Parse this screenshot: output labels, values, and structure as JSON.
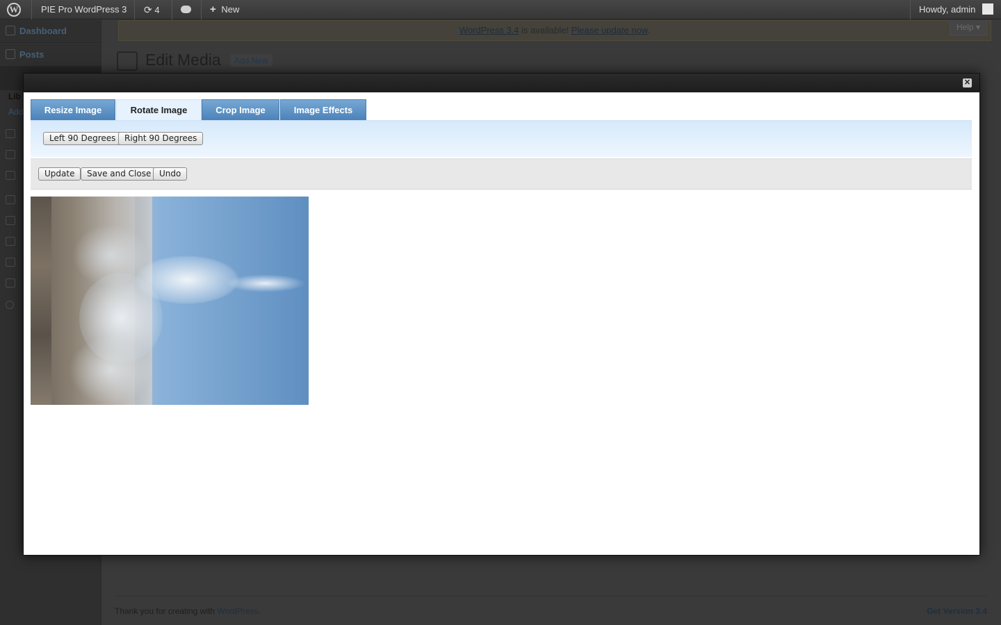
{
  "admin_bar": {
    "site_name": "PIE Pro WordPress 3",
    "updates_count": "4",
    "new_label": "New",
    "greeting": "Howdy, admin"
  },
  "admin_menu": {
    "items": [
      {
        "label": "Dashboard",
        "icon": "home-icon"
      },
      {
        "label": "Posts",
        "icon": "pin-icon"
      }
    ],
    "fragments": {
      "library": "Lib",
      "add": "Add"
    }
  },
  "notice": {
    "link_version": "WordPress 3.4",
    "middle": " is available! ",
    "link_update": "Please update now",
    "end": "."
  },
  "help_tab": "Help",
  "page": {
    "title": "Edit Media",
    "add_new": "Add New"
  },
  "modal": {
    "tabs": [
      {
        "label": "Resize Image",
        "active": false
      },
      {
        "label": "Rotate Image",
        "active": true
      },
      {
        "label": "Crop Image",
        "active": false
      },
      {
        "label": "Image Effects",
        "active": false
      }
    ],
    "rotate_buttons": {
      "left": "Left 90 Degrees",
      "right": "Right 90 Degrees"
    },
    "actions": {
      "update": "Update",
      "save_close": "Save and Close",
      "undo": "Undo"
    },
    "close_glyph": "✕"
  },
  "footer": {
    "thanks": "Thank you for creating with ",
    "link": "WordPress",
    "end": ".",
    "version": "Get Version 3.4"
  },
  "colors": {
    "tab_active_bg": "#e6f2fd",
    "tab_bg": "#4b82b9",
    "panel_bg": "#d6e9fb",
    "action_bar_bg": "#e8e8e8"
  }
}
